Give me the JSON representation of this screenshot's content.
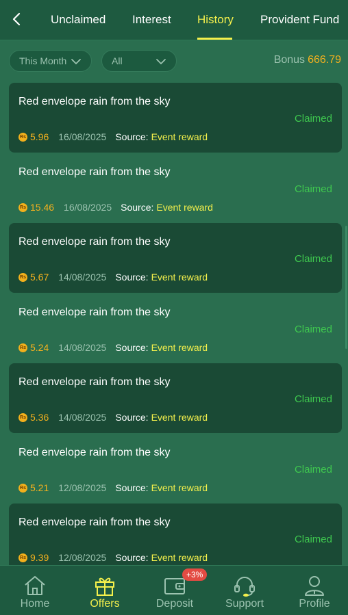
{
  "header": {
    "tabs": [
      {
        "label": "Unclaimed"
      },
      {
        "label": "Interest"
      },
      {
        "label": "History"
      },
      {
        "label": "Provident Fund"
      }
    ],
    "active_tab": "History"
  },
  "filters": {
    "period": "This Month",
    "type": "All",
    "bonus_label": "Bonus",
    "bonus_value": "666.79"
  },
  "records": [
    {
      "title": "Red envelope rain from the sky",
      "status": "Claimed",
      "coin": "Rs",
      "amount": "5.96",
      "date": "16/08/2025",
      "source_label": "Source:",
      "source": "Event reward"
    },
    {
      "title": "Red envelope rain from the sky",
      "status": "Claimed",
      "coin": "Rs",
      "amount": "15.46",
      "date": "16/08/2025",
      "source_label": "Source:",
      "source": "Event reward"
    },
    {
      "title": "Red envelope rain from the sky",
      "status": "Claimed",
      "coin": "Rs",
      "amount": "5.67",
      "date": "14/08/2025",
      "source_label": "Source:",
      "source": "Event reward"
    },
    {
      "title": "Red envelope rain from the sky",
      "status": "Claimed",
      "coin": "Rs",
      "amount": "5.24",
      "date": "14/08/2025",
      "source_label": "Source:",
      "source": "Event reward"
    },
    {
      "title": "Red envelope rain from the sky",
      "status": "Claimed",
      "coin": "Rs",
      "amount": "5.36",
      "date": "14/08/2025",
      "source_label": "Source:",
      "source": "Event reward"
    },
    {
      "title": "Red envelope rain from the sky",
      "status": "Claimed",
      "coin": "Rs",
      "amount": "5.21",
      "date": "12/08/2025",
      "source_label": "Source:",
      "source": "Event reward"
    },
    {
      "title": "Red envelope rain from the sky",
      "status": "Claimed",
      "coin": "Rs",
      "amount": "9.39",
      "date": "12/08/2025",
      "source_label": "Source:",
      "source": "Event reward"
    }
  ],
  "bottom_nav": {
    "items": [
      {
        "label": "Home",
        "icon": "home-icon"
      },
      {
        "label": "Offers",
        "icon": "gift-icon"
      },
      {
        "label": "Deposit",
        "icon": "wallet-icon"
      },
      {
        "label": "Support",
        "icon": "headset-icon"
      },
      {
        "label": "Profile",
        "icon": "user-icon"
      }
    ],
    "active": "Offers",
    "deposit_badge": "+3%"
  },
  "colors": {
    "accent": "#f4f04c",
    "amount": "#f5b11e",
    "claimed": "#3fc94f",
    "background": "#2a6e4f",
    "card_dark": "#1a4a35"
  }
}
